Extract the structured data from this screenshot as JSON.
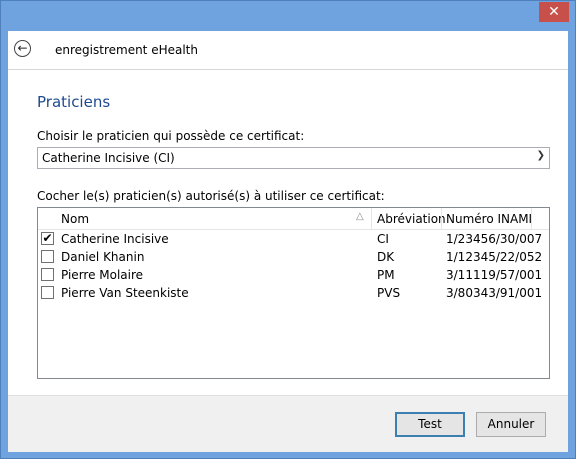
{
  "window": {
    "close_glyph": "✕"
  },
  "header": {
    "back_glyph": "←",
    "title": "enregistrement eHealth"
  },
  "main": {
    "section_title": "Praticiens",
    "owner_label": "Choisir le praticien qui possède ce certificat:",
    "owner_value": "Catherine Incisive (CI)",
    "authorized_label": "Cocher le(s) praticien(s) autorisé(s) à utiliser ce certificat:",
    "table": {
      "columns": [
        "Nom",
        "Abréviation",
        "Numéro INAMI"
      ],
      "sort_glyph": "△",
      "rows": [
        {
          "checked": true,
          "check": "✔",
          "name": "Catherine Incisive",
          "abbr": "CI",
          "inami": "1/23456/30/007"
        },
        {
          "checked": false,
          "check": "",
          "name": "Daniel Khanin",
          "abbr": "DK",
          "inami": "1/12345/22/052"
        },
        {
          "checked": false,
          "check": "",
          "name": "Pierre Molaire",
          "abbr": "PM",
          "inami": "3/11119/57/001"
        },
        {
          "checked": false,
          "check": "",
          "name": "Pierre Van Steenkiste",
          "abbr": "PVS",
          "inami": "3/80343/91/001"
        }
      ]
    }
  },
  "footer": {
    "test_label": "Test",
    "cancel_label": "Annuler"
  },
  "colors": {
    "accent": "#1e4a8f",
    "chrome": "#6fa3df",
    "close": "#c7504a"
  }
}
